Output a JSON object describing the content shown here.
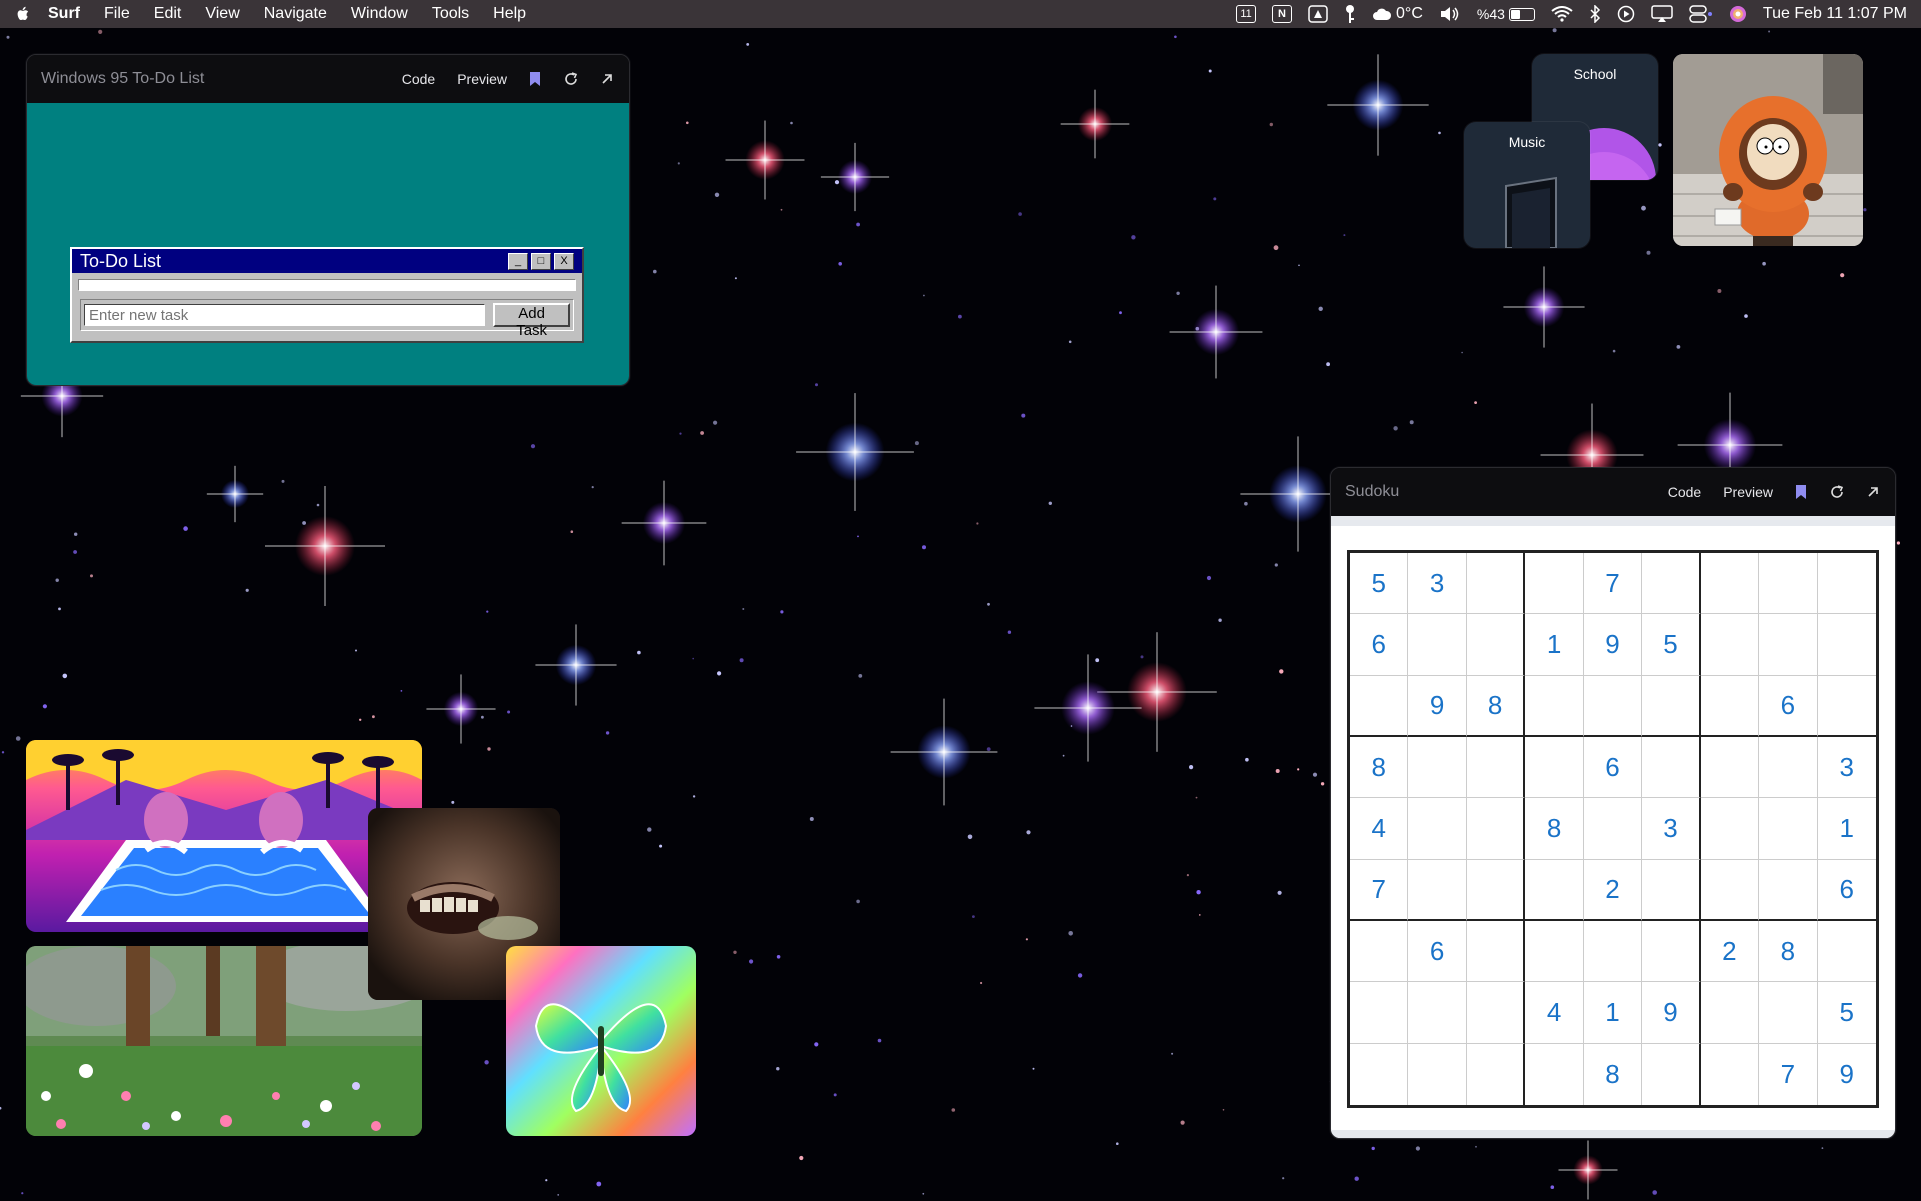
{
  "menubar": {
    "app": "Surf",
    "menus": [
      "File",
      "Edit",
      "View",
      "Navigate",
      "Window",
      "Tools",
      "Help"
    ],
    "status": {
      "calendar_badge": "11",
      "notion_badge": "N",
      "weather": "0°C",
      "battery": "%43",
      "battery_level": 0.43,
      "datetime": "Tue Feb 11  1:07 PM"
    }
  },
  "todo_window": {
    "title": "Windows 95 To-Do List",
    "code_label": "Code",
    "preview_label": "Preview",
    "dialog": {
      "title": "To-Do List",
      "minimize": "_",
      "maximize": "□",
      "close": "X",
      "input_placeholder": "Enter new task",
      "add_label": "Add Task"
    }
  },
  "sudoku_window": {
    "title": "Sudoku",
    "code_label": "Code",
    "preview_label": "Preview",
    "grid": [
      [
        "5",
        "3",
        "",
        "",
        "7",
        "",
        "",
        "",
        ""
      ],
      [
        "6",
        "",
        "",
        "1",
        "9",
        "5",
        "",
        "",
        ""
      ],
      [
        "",
        "9",
        "8",
        "",
        "",
        "",
        "",
        "6",
        ""
      ],
      [
        "8",
        "",
        "",
        "",
        "6",
        "",
        "",
        "",
        "3"
      ],
      [
        "4",
        "",
        "",
        "8",
        "",
        "3",
        "",
        "",
        "1"
      ],
      [
        "7",
        "",
        "",
        "",
        "2",
        "",
        "",
        "",
        "6"
      ],
      [
        "",
        "6",
        "",
        "",
        "",
        "",
        "2",
        "8",
        ""
      ],
      [
        "",
        "",
        "",
        "4",
        "1",
        "9",
        "",
        "",
        "5"
      ],
      [
        "",
        "",
        "",
        "",
        "8",
        "",
        "",
        "7",
        "9"
      ]
    ]
  },
  "folders": [
    {
      "label": "School",
      "accent": "#b155e8"
    },
    {
      "label": "Music",
      "accent": "#1a2230"
    }
  ]
}
